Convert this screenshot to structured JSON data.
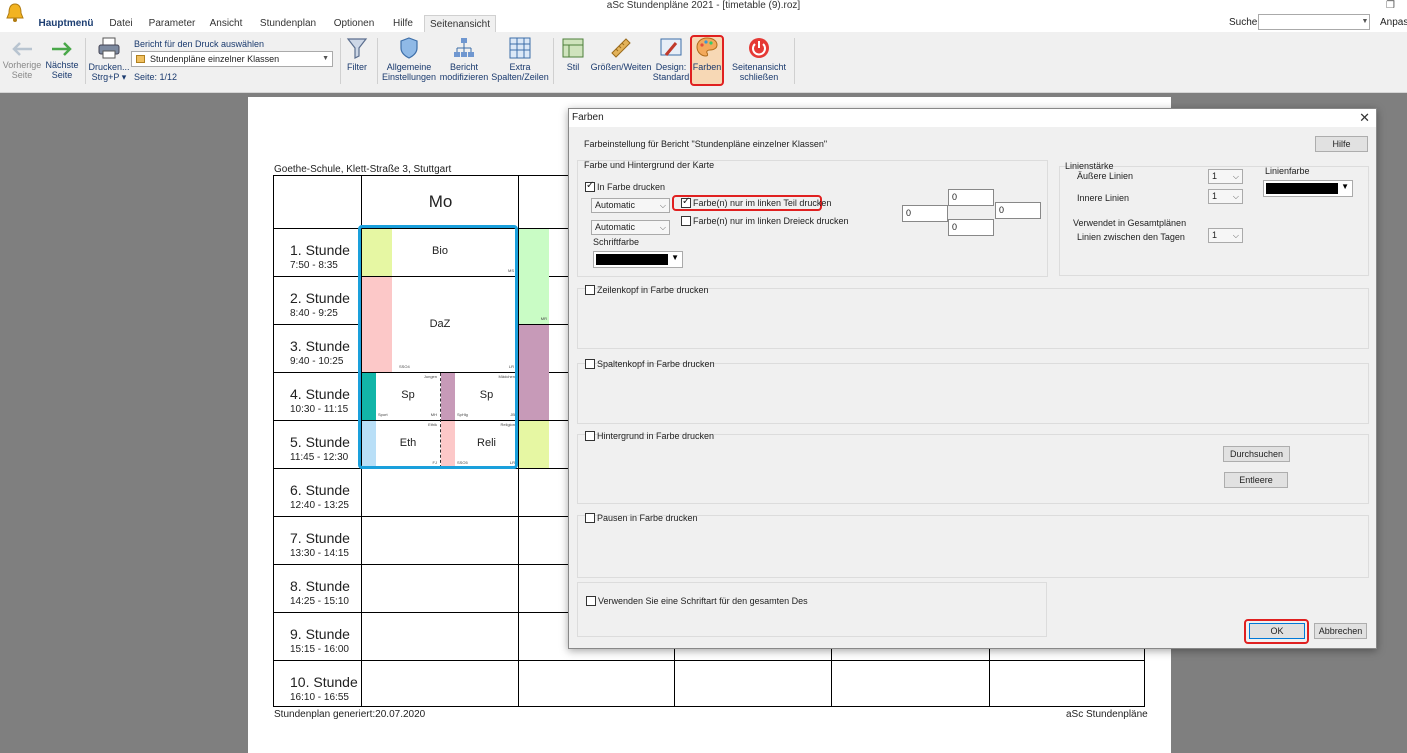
{
  "window": {
    "title": "aSc Stundenpläne 2021  - [timetable (9).roz]"
  },
  "menu": {
    "tabs": [
      "Hauptmenü",
      "Datei",
      "Parameter",
      "Ansicht",
      "Stundenplan",
      "Optionen",
      "Hilfe",
      "Seitenansicht"
    ],
    "active": "Seitenansicht",
    "search_label": "Suche:",
    "search_value": "",
    "right_label": "Anpass"
  },
  "ribbon": {
    "prev_page": "Vorherige Seite",
    "next_page": "Nächste Seite",
    "print": "Drucken...",
    "print_shortcut": "Strg+P",
    "report_label": "Bericht für den Druck auswählen",
    "report_selected": "Stundenpläne einzelner Klassen",
    "page_info": "Seite: 1/12",
    "filter": "Filter",
    "general_settings_1": "Allgemeine",
    "general_settings_2": "Einstellungen",
    "modify_report_1": "Bericht",
    "modify_report_2": "modifizieren",
    "extra_cols_1": "Extra",
    "extra_cols_2": "Spalten/Zeilen",
    "style": "Stil",
    "sizes": "Größen/Weiten",
    "design_1": "Design:",
    "design_2": "Standard",
    "colors": "Farben",
    "close_preview_1": "Seitenansicht",
    "close_preview_2": "schließen"
  },
  "paper": {
    "school": "Goethe-Schule, Klett-Straße 3, Stuttgart",
    "day": "Mo",
    "periods": [
      {
        "name": "1. Stunde",
        "time": "7:50 - 8:35"
      },
      {
        "name": "2. Stunde",
        "time": "8:40 - 9:25"
      },
      {
        "name": "3. Stunde",
        "time": "9:40 - 10:25"
      },
      {
        "name": "4. Stunde",
        "time": "10:30 - 11:15"
      },
      {
        "name": "5. Stunde",
        "time": "11:45 - 12:30"
      },
      {
        "name": "6. Stunde",
        "time": "12:40 - 13:25"
      },
      {
        "name": "7. Stunde",
        "time": "13:30 - 14:15"
      },
      {
        "name": "8. Stunde",
        "time": "14:25 - 15:10"
      },
      {
        "name": "9. Stunde",
        "time": "15:15 - 16:00"
      },
      {
        "name": "10. Stunde",
        "time": "16:10 - 16:55"
      }
    ],
    "lessons": {
      "bio": {
        "subject": "Bio",
        "teacher": "MS"
      },
      "daz": {
        "subject": "DaZ",
        "room": "SSO4",
        "teacher": "LR"
      },
      "sp1": {
        "subject": "Sp",
        "group": "Jungen",
        "room": "Sport",
        "teacher": "MH"
      },
      "sp2": {
        "subject": "Sp",
        "group": "Mädchen",
        "room": "SpHlg",
        "teacher": "JB"
      },
      "eth": {
        "subject": "Eth",
        "group": "Ethik",
        "teacher": "FJ"
      },
      "reli": {
        "subject": "Reli",
        "group": "Religion",
        "room": "SSO5",
        "teacher": "LR"
      },
      "col2_teacher": "MR"
    },
    "colors": {
      "bio": "#e6f7a3",
      "daz": "#fcc8c8",
      "sp1": "#12b5a8",
      "sp2": "#c79ab8",
      "eth": "#b9dff7",
      "reli": "#fcc8c8",
      "col2_a": "#c9fcc5",
      "col2_b": "#c79ab8",
      "col2_c": "#e6f7a3",
      "highlight": "#1aa0dc"
    },
    "footer_left": "Stundenplan generiert:20.07.2020",
    "footer_right": "aSc Stundenpläne"
  },
  "dialog": {
    "title": "Farben",
    "subtitle": "Farbeinstellung für Bericht \"Stundenpläne einzelner Klassen\"",
    "help": "Hilfe",
    "section_card": "Farbe und Hintergrund der Karte",
    "in_color": "In Farbe drucken",
    "left_part": "Farbe(n) nur im linken Teil drucken",
    "left_triangle": "Farbe(n) nur im linken Dreieck drucken",
    "combo1": "Automatic",
    "combo2": "Automatic",
    "font_color": "Schriftfarbe",
    "margins": [
      "0",
      "0",
      "0",
      "0"
    ],
    "line_strength": "Linienstärke",
    "outer_lines": "Äußere Linien",
    "outer_value": "1",
    "inner_lines": "Innere Linien",
    "inner_value": "1",
    "line_color": "Linienfarbe",
    "used_in_overall": "Verwendet in Gesamtplänen",
    "lines_between_days": "Linien zwischen den Tagen",
    "between_value": "1",
    "row_header": "Zeilenkopf in Farbe drucken",
    "col_header": "Spaltenkopf in Farbe drucken",
    "background": "Hintergrund in Farbe drucken",
    "browse": "Durchsuchen",
    "clear": "Entleere",
    "breaks": "Pausen in Farbe drucken",
    "single_font": "Verwenden Sie eine Schriftart für den gesamten Des",
    "ok": "OK",
    "cancel": "Abbrechen"
  }
}
